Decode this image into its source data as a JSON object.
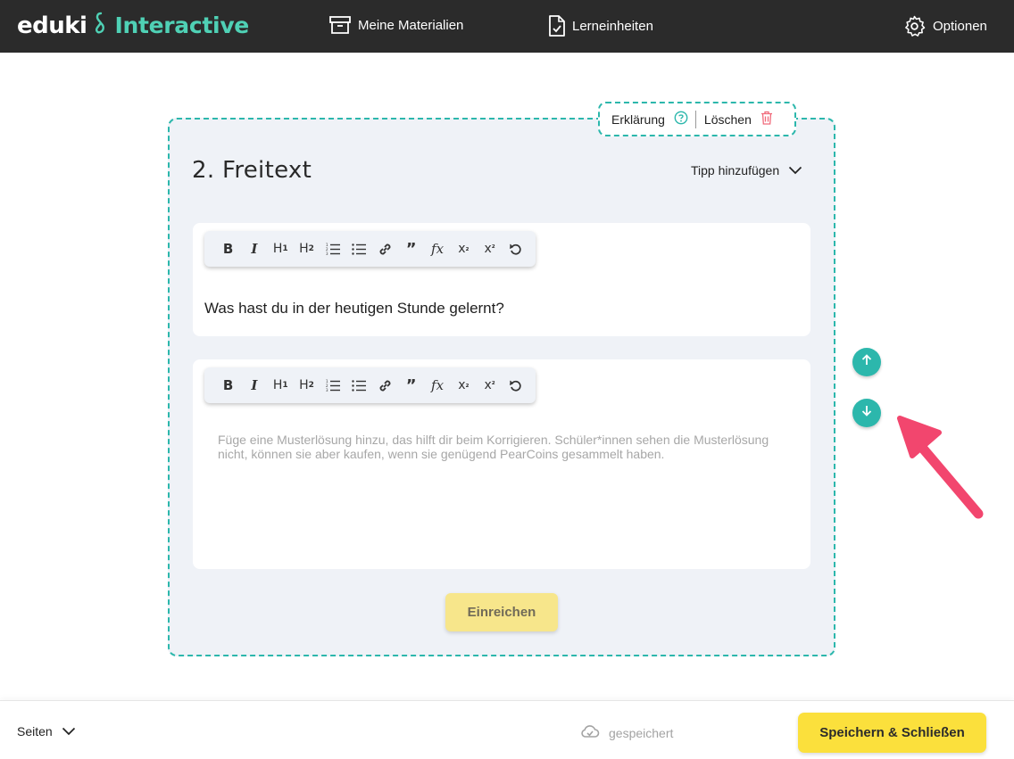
{
  "header": {
    "logo": "eduki",
    "logo_sub": "Interactive",
    "nav": {
      "materials": "Meine Materialien",
      "units": "Lerneinheiten",
      "options": "Optionen"
    }
  },
  "card": {
    "tools": {
      "explain": "Erklärung",
      "delete": "Löschen"
    },
    "title": "2. Freitext",
    "tip": "Tipp hinzufügen",
    "toolbar": {
      "sub": "₂",
      "sup": "²"
    },
    "question_text": "Was hast du in der heutigen Stunde gelernt?",
    "solution_placeholder": "Füge eine Musterlösung hinzu, das hilft dir beim Korrigieren. Schüler*innen sehen die Musterlösung nicht, können sie aber kaufen, wenn sie genügend PearCoins gesammelt haben.",
    "submit": "Einreichen"
  },
  "footer": {
    "pages": "Seiten",
    "status": "gespeichert",
    "save_close": "Speichern & Schließen"
  },
  "colors": {
    "accent": "#2cb7ac",
    "logo_accent": "#4fd1b5",
    "submit_bg": "#f7e68b",
    "save_bg": "#fbe03c",
    "annotation_arrow": "#f2466e",
    "delete_icon": "#f06a7a"
  },
  "icons": [
    "archive-icon",
    "document-check-icon",
    "gear-icon",
    "help-circle-icon",
    "trash-icon",
    "chevron-down-icon",
    "arrow-up-icon",
    "arrow-down-icon",
    "cloud-check-icon"
  ]
}
